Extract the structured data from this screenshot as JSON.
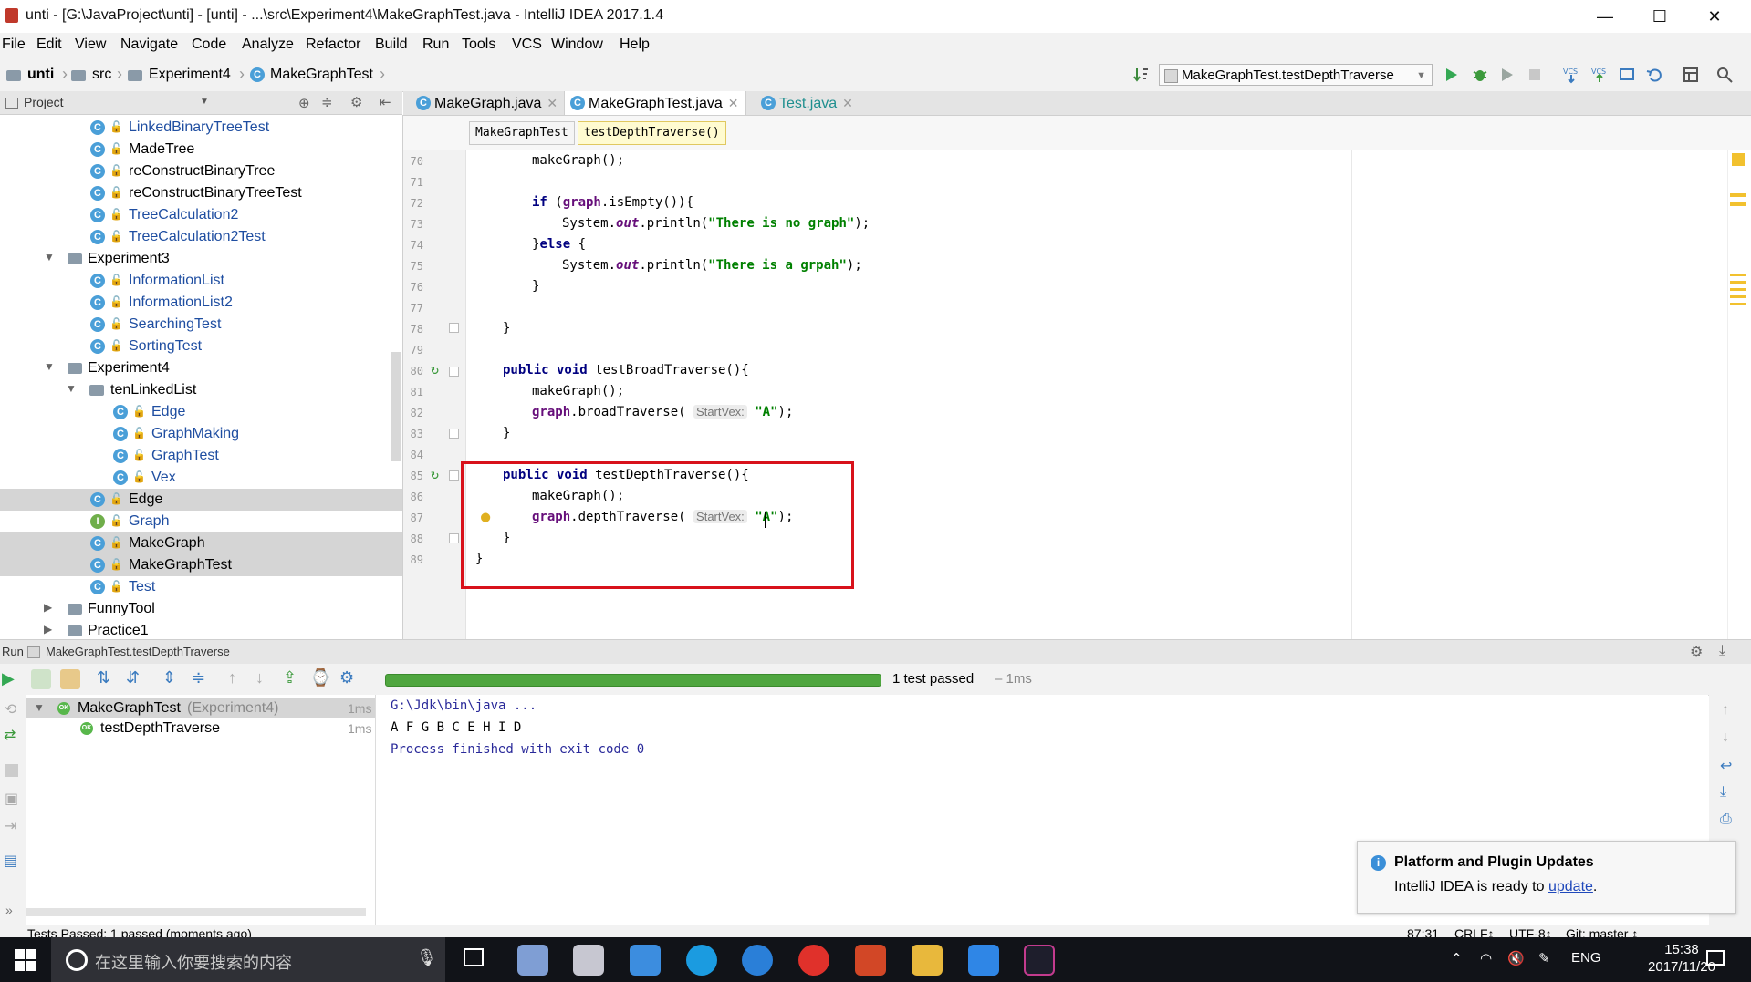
{
  "window": {
    "title": "unti - [G:\\JavaProject\\unti] - [unti] - ...\\src\\Experiment4\\MakeGraphTest.java - IntelliJ IDEA 2017.1.4",
    "minimize": "—",
    "maximize": "☐",
    "close": "✕"
  },
  "menu": [
    "File",
    "Edit",
    "View",
    "Navigate",
    "Code",
    "Analyze",
    "Refactor",
    "Build",
    "Run",
    "Tools",
    "VCS",
    "Window",
    "Help"
  ],
  "breadcrumbs": [
    "unti",
    "src",
    "Experiment4",
    "MakeGraphTest"
  ],
  "run_config": "MakeGraphTest.testDepthTraverse",
  "project_panel": {
    "title": "Project",
    "tree": [
      {
        "label": "LinkedBinaryTreeTest",
        "icon": "class-icon"
      },
      {
        "label": "MadeTree",
        "icon": "class-icon"
      },
      {
        "label": "reConstructBinaryTree",
        "icon": "class-icon"
      },
      {
        "label": "reConstructBinaryTreeTest",
        "icon": "class-icon"
      },
      {
        "label": "TreeCalculation2",
        "icon": "class-icon"
      },
      {
        "label": "TreeCalculation2Test",
        "icon": "class-icon"
      },
      {
        "label": "Experiment3",
        "icon": "folder-icon"
      },
      {
        "label": "InformationList",
        "icon": "class-icon"
      },
      {
        "label": "InformationList2",
        "icon": "class-icon"
      },
      {
        "label": "SearchingTest",
        "icon": "class-icon"
      },
      {
        "label": "SortingTest",
        "icon": "class-icon"
      },
      {
        "label": "Experiment4",
        "icon": "folder-icon"
      },
      {
        "label": "tenLinkedList",
        "icon": "folder-icon"
      },
      {
        "label": "Edge",
        "icon": "class-icon"
      },
      {
        "label": "GraphMaking",
        "icon": "class-icon"
      },
      {
        "label": "GraphTest",
        "icon": "class-icon"
      },
      {
        "label": "Vex",
        "icon": "class-icon"
      },
      {
        "label": "Edge",
        "icon": "class-icon"
      },
      {
        "label": "Graph",
        "icon": "interface-icon"
      },
      {
        "label": "MakeGraph",
        "icon": "class-icon"
      },
      {
        "label": "MakeGraphTest",
        "icon": "class-icon"
      },
      {
        "label": "Test",
        "icon": "class-icon"
      },
      {
        "label": "FunnyTool",
        "icon": "folder-icon"
      },
      {
        "label": "Practice1",
        "icon": "folder-icon"
      }
    ]
  },
  "tabs": [
    {
      "label": "MakeGraph.java"
    },
    {
      "label": "MakeGraphTest.java"
    },
    {
      "label": "Test.java"
    }
  ],
  "editor_breadcrumb": [
    "MakeGraphTest",
    "testDepthTraverse()"
  ],
  "code": {
    "line_numbers": [
      "70",
      "71",
      "72",
      "73",
      "74",
      "75",
      "76",
      "77",
      "78",
      "79",
      "80",
      "81",
      "82",
      "83",
      "84",
      "85",
      "86",
      "87",
      "88",
      "89"
    ],
    "lines": {
      "l70": "makeGraph();",
      "l72_kw": "if",
      "l72_a": " (",
      "l72_field": "graph",
      "l72_b": ".isEmpty()){",
      "l73_a": "System.",
      "l73_out": "out",
      "l73_b": ".println(",
      "l73_str": "\"There is no graph\"",
      "l73_c": ");",
      "l74_a": "}",
      "l74_kw": "else",
      "l74_b": " {",
      "l75_a": "System.",
      "l75_out": "out",
      "l75_b": ".println(",
      "l75_str": "\"There is a grpah\"",
      "l75_c": ");",
      "l76": "}",
      "l78": "}",
      "l80_kw": "public void",
      "l80_rest": " testBroadTraverse(){",
      "l81": "makeGraph();",
      "l82_field": "graph",
      "l82_a": ".broadTraverse(",
      "l82_hint": "StartVex:",
      "l82_str": "\"A\"",
      "l82_c": ");",
      "l83": "}",
      "l85_kw": "public void",
      "l85_rest": " testDepthTraverse(){",
      "l86": "makeGraph();",
      "l87_field": "graph",
      "l87_a": ".depthTraverse(",
      "l87_hint": "StartVex:",
      "l87_str": "\"A\"",
      "l87_c": ");",
      "l88": "}",
      "l89": "}"
    }
  },
  "run_panel": {
    "label": "Run",
    "config": "MakeGraphTest.testDepthTraverse",
    "status": "1 test passed",
    "duration": "– 1ms",
    "progress": 1.0,
    "tree": [
      {
        "name": "MakeGraphTest",
        "context": "(Experiment4)",
        "time": "1ms"
      },
      {
        "name": "testDepthTraverse",
        "context": "",
        "time": "1ms"
      }
    ],
    "console": [
      "G:\\Jdk\\bin\\java ...",
      "A F G B C E H I D",
      "Process finished with exit code 0"
    ]
  },
  "status_bar": {
    "message": "Tests Passed: 1 passed (moments ago)",
    "position": "87:31",
    "line_sep": "CRLF↕",
    "encoding": "UTF-8↕",
    "git": "Git: master ↕"
  },
  "notification": {
    "title": "Platform and Plugin Updates",
    "body": "IntelliJ IDEA is ready to ",
    "link": "update",
    "tail": "."
  },
  "taskbar": {
    "search_placeholder": "在这里输入你要搜索的内容",
    "time": "15:38",
    "date": "2017/11/20",
    "lang": "ENG"
  },
  "colors": {
    "accent_red": "#d8111b",
    "pass_green": "#4fa63f",
    "keyword": "#000080",
    "string": "#008000"
  }
}
